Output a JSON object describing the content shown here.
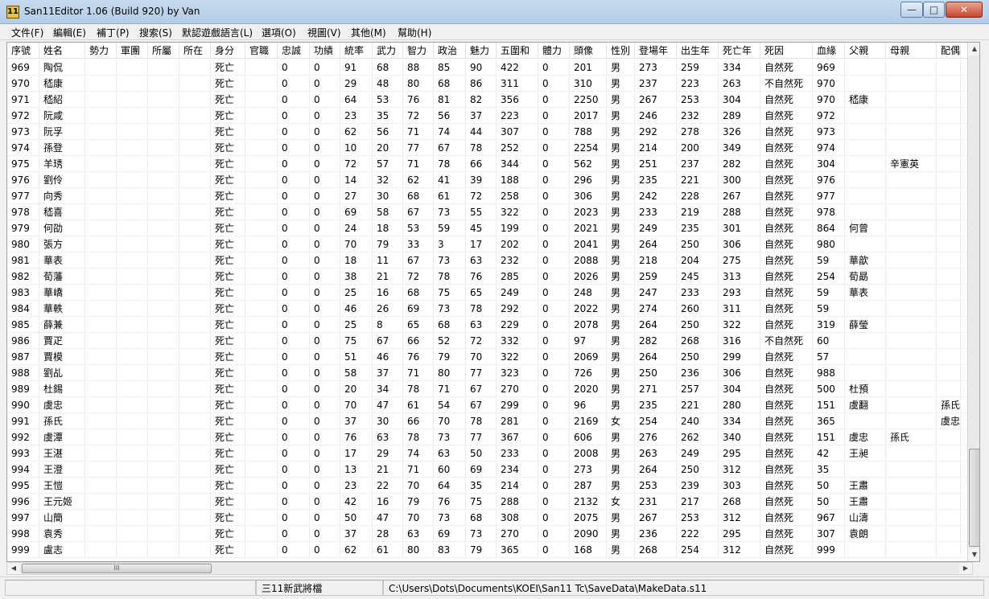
{
  "window": {
    "title": "San11Editor 1.06 (Build 920) by Van",
    "app_icon_text": "11",
    "min_glyph": "—",
    "max_glyph": "□",
    "close_glyph": "✕"
  },
  "menu": [
    "文件(F)",
    "編輯(E)",
    "補丁(P)",
    "搜索(S)",
    "默認遊戲語言(L)",
    "選項(O)",
    "視圖(V)",
    "其他(M)",
    "幫助(H)"
  ],
  "table": {
    "columns": [
      "序號",
      "姓名",
      "勢力",
      "軍團",
      "所屬",
      "所在",
      "身分",
      "官職",
      "忠誠",
      "功績",
      "統率",
      "武力",
      "智力",
      "政治",
      "魅力",
      "五圍和",
      "體力",
      "頭像",
      "性別",
      "登場年",
      "出生年",
      "死亡年",
      "死因",
      "血緣",
      "父親",
      "母親",
      "配偶"
    ],
    "rows": [
      [
        "969",
        "陶侃",
        "",
        "",
        "",
        "",
        "死亡",
        "",
        "0",
        "0",
        "91",
        "68",
        "88",
        "85",
        "90",
        "422",
        "0",
        "201",
        "男",
        "273",
        "259",
        "334",
        "自然死",
        "969",
        "",
        "",
        ""
      ],
      [
        "970",
        "嵇康",
        "",
        "",
        "",
        "",
        "死亡",
        "",
        "0",
        "0",
        "29",
        "48",
        "80",
        "68",
        "86",
        "311",
        "0",
        "310",
        "男",
        "237",
        "223",
        "263",
        "不自然死",
        "970",
        "",
        "",
        ""
      ],
      [
        "971",
        "嵇紹",
        "",
        "",
        "",
        "",
        "死亡",
        "",
        "0",
        "0",
        "64",
        "53",
        "76",
        "81",
        "82",
        "356",
        "0",
        "2250",
        "男",
        "267",
        "253",
        "304",
        "自然死",
        "970",
        "嵇康",
        "",
        ""
      ],
      [
        "972",
        "阮咸",
        "",
        "",
        "",
        "",
        "死亡",
        "",
        "0",
        "0",
        "23",
        "35",
        "72",
        "56",
        "37",
        "223",
        "0",
        "2017",
        "男",
        "246",
        "232",
        "289",
        "自然死",
        "972",
        "",
        "",
        ""
      ],
      [
        "973",
        "阮孚",
        "",
        "",
        "",
        "",
        "死亡",
        "",
        "0",
        "0",
        "62",
        "56",
        "71",
        "74",
        "44",
        "307",
        "0",
        "788",
        "男",
        "292",
        "278",
        "326",
        "自然死",
        "973",
        "",
        "",
        ""
      ],
      [
        "974",
        "孫登",
        "",
        "",
        "",
        "",
        "死亡",
        "",
        "0",
        "0",
        "10",
        "20",
        "77",
        "67",
        "78",
        "252",
        "0",
        "2254",
        "男",
        "214",
        "200",
        "349",
        "自然死",
        "974",
        "",
        "",
        ""
      ],
      [
        "975",
        "羊琇",
        "",
        "",
        "",
        "",
        "死亡",
        "",
        "0",
        "0",
        "72",
        "57",
        "71",
        "78",
        "66",
        "344",
        "0",
        "562",
        "男",
        "251",
        "237",
        "282",
        "自然死",
        "304",
        "",
        "辛憲英",
        ""
      ],
      [
        "976",
        "劉伶",
        "",
        "",
        "",
        "",
        "死亡",
        "",
        "0",
        "0",
        "14",
        "32",
        "62",
        "41",
        "39",
        "188",
        "0",
        "296",
        "男",
        "235",
        "221",
        "300",
        "自然死",
        "976",
        "",
        "",
        ""
      ],
      [
        "977",
        "向秀",
        "",
        "",
        "",
        "",
        "死亡",
        "",
        "0",
        "0",
        "27",
        "30",
        "68",
        "61",
        "72",
        "258",
        "0",
        "306",
        "男",
        "242",
        "228",
        "267",
        "自然死",
        "977",
        "",
        "",
        ""
      ],
      [
        "978",
        "嵇喜",
        "",
        "",
        "",
        "",
        "死亡",
        "",
        "0",
        "0",
        "69",
        "58",
        "67",
        "73",
        "55",
        "322",
        "0",
        "2023",
        "男",
        "233",
        "219",
        "288",
        "自然死",
        "978",
        "",
        "",
        ""
      ],
      [
        "979",
        "何劭",
        "",
        "",
        "",
        "",
        "死亡",
        "",
        "0",
        "0",
        "24",
        "18",
        "53",
        "59",
        "45",
        "199",
        "0",
        "2021",
        "男",
        "249",
        "235",
        "301",
        "自然死",
        "864",
        "何曾",
        "",
        ""
      ],
      [
        "980",
        "張方",
        "",
        "",
        "",
        "",
        "死亡",
        "",
        "0",
        "0",
        "70",
        "79",
        "33",
        "3",
        "17",
        "202",
        "0",
        "2041",
        "男",
        "264",
        "250",
        "306",
        "自然死",
        "980",
        "",
        "",
        ""
      ],
      [
        "981",
        "華表",
        "",
        "",
        "",
        "",
        "死亡",
        "",
        "0",
        "0",
        "18",
        "11",
        "67",
        "73",
        "63",
        "232",
        "0",
        "2088",
        "男",
        "218",
        "204",
        "275",
        "自然死",
        "59",
        "華歆",
        "",
        ""
      ],
      [
        "982",
        "荀藩",
        "",
        "",
        "",
        "",
        "死亡",
        "",
        "0",
        "0",
        "38",
        "21",
        "72",
        "78",
        "76",
        "285",
        "0",
        "2026",
        "男",
        "259",
        "245",
        "313",
        "自然死",
        "254",
        "荀勗",
        "",
        ""
      ],
      [
        "983",
        "華嶠",
        "",
        "",
        "",
        "",
        "死亡",
        "",
        "0",
        "0",
        "25",
        "16",
        "68",
        "75",
        "65",
        "249",
        "0",
        "248",
        "男",
        "247",
        "233",
        "293",
        "自然死",
        "59",
        "華表",
        "",
        ""
      ],
      [
        "984",
        "華軼",
        "",
        "",
        "",
        "",
        "死亡",
        "",
        "0",
        "0",
        "46",
        "26",
        "69",
        "73",
        "78",
        "292",
        "0",
        "2022",
        "男",
        "274",
        "260",
        "311",
        "自然死",
        "59",
        "",
        "",
        ""
      ],
      [
        "985",
        "薛兼",
        "",
        "",
        "",
        "",
        "死亡",
        "",
        "0",
        "0",
        "25",
        "8",
        "65",
        "68",
        "63",
        "229",
        "0",
        "2078",
        "男",
        "264",
        "250",
        "322",
        "自然死",
        "319",
        "薛瑩",
        "",
        ""
      ],
      [
        "986",
        "賈疋",
        "",
        "",
        "",
        "",
        "死亡",
        "",
        "0",
        "0",
        "75",
        "67",
        "66",
        "52",
        "72",
        "332",
        "0",
        "97",
        "男",
        "282",
        "268",
        "316",
        "不自然死",
        "60",
        "",
        "",
        ""
      ],
      [
        "987",
        "賈模",
        "",
        "",
        "",
        "",
        "死亡",
        "",
        "0",
        "0",
        "51",
        "46",
        "76",
        "79",
        "70",
        "322",
        "0",
        "2069",
        "男",
        "264",
        "250",
        "299",
        "自然死",
        "57",
        "",
        "",
        ""
      ],
      [
        "988",
        "劉乩",
        "",
        "",
        "",
        "",
        "死亡",
        "",
        "0",
        "0",
        "58",
        "37",
        "71",
        "80",
        "77",
        "323",
        "0",
        "726",
        "男",
        "250",
        "236",
        "306",
        "自然死",
        "988",
        "",
        "",
        ""
      ],
      [
        "989",
        "杜錫",
        "",
        "",
        "",
        "",
        "死亡",
        "",
        "0",
        "0",
        "20",
        "34",
        "78",
        "71",
        "67",
        "270",
        "0",
        "2020",
        "男",
        "271",
        "257",
        "304",
        "自然死",
        "500",
        "杜預",
        "",
        ""
      ],
      [
        "990",
        "虞忠",
        "",
        "",
        "",
        "",
        "死亡",
        "",
        "0",
        "0",
        "70",
        "47",
        "61",
        "54",
        "67",
        "299",
        "0",
        "96",
        "男",
        "235",
        "221",
        "280",
        "自然死",
        "151",
        "虞翻",
        "",
        "孫氏"
      ],
      [
        "991",
        "孫氏",
        "",
        "",
        "",
        "",
        "死亡",
        "",
        "0",
        "0",
        "37",
        "30",
        "66",
        "70",
        "78",
        "281",
        "0",
        "2169",
        "女",
        "254",
        "240",
        "334",
        "自然死",
        "365",
        "",
        "",
        "虞忠"
      ],
      [
        "992",
        "虞潭",
        "",
        "",
        "",
        "",
        "死亡",
        "",
        "0",
        "0",
        "76",
        "63",
        "78",
        "73",
        "77",
        "367",
        "0",
        "606",
        "男",
        "276",
        "262",
        "340",
        "自然死",
        "151",
        "虞忠",
        "孫氏",
        ""
      ],
      [
        "993",
        "王湛",
        "",
        "",
        "",
        "",
        "死亡",
        "",
        "0",
        "0",
        "17",
        "29",
        "74",
        "63",
        "50",
        "233",
        "0",
        "2008",
        "男",
        "263",
        "249",
        "295",
        "自然死",
        "42",
        "王昶",
        "",
        ""
      ],
      [
        "994",
        "王澄",
        "",
        "",
        "",
        "",
        "死亡",
        "",
        "0",
        "0",
        "13",
        "21",
        "71",
        "60",
        "69",
        "234",
        "0",
        "273",
        "男",
        "264",
        "250",
        "312",
        "自然死",
        "35",
        "",
        "",
        ""
      ],
      [
        "995",
        "王愷",
        "",
        "",
        "",
        "",
        "死亡",
        "",
        "0",
        "0",
        "23",
        "22",
        "70",
        "64",
        "35",
        "214",
        "0",
        "287",
        "男",
        "253",
        "239",
        "303",
        "自然死",
        "50",
        "王肅",
        "",
        ""
      ],
      [
        "996",
        "王元姬",
        "",
        "",
        "",
        "",
        "死亡",
        "",
        "0",
        "0",
        "42",
        "16",
        "79",
        "76",
        "75",
        "288",
        "0",
        "2132",
        "女",
        "231",
        "217",
        "268",
        "自然死",
        "50",
        "王肅",
        "",
        ""
      ],
      [
        "997",
        "山簡",
        "",
        "",
        "",
        "",
        "死亡",
        "",
        "0",
        "0",
        "50",
        "47",
        "70",
        "73",
        "68",
        "308",
        "0",
        "2075",
        "男",
        "267",
        "253",
        "312",
        "自然死",
        "967",
        "山濤",
        "",
        ""
      ],
      [
        "998",
        "袁秀",
        "",
        "",
        "",
        "",
        "死亡",
        "",
        "0",
        "0",
        "37",
        "28",
        "63",
        "69",
        "73",
        "270",
        "0",
        "2090",
        "男",
        "236",
        "222",
        "295",
        "自然死",
        "307",
        "袁朗",
        "",
        ""
      ],
      [
        "999",
        "盧志",
        "",
        "",
        "",
        "",
        "死亡",
        "",
        "0",
        "0",
        "62",
        "61",
        "80",
        "83",
        "79",
        "365",
        "0",
        "168",
        "男",
        "268",
        "254",
        "312",
        "自然死",
        "999",
        "",
        "",
        ""
      ]
    ]
  },
  "scroll": {
    "up_glyph": "▲",
    "down_glyph": "▼",
    "left_glyph": "◀",
    "right_glyph": "▶",
    "grip_glyph": "III"
  },
  "status": {
    "pane1": "",
    "pane2": "三11新武將檔",
    "pane3": "C:\\Users\\Dots\\Documents\\KOEI\\San11 Tc\\SaveData\\MakeData.s11"
  }
}
